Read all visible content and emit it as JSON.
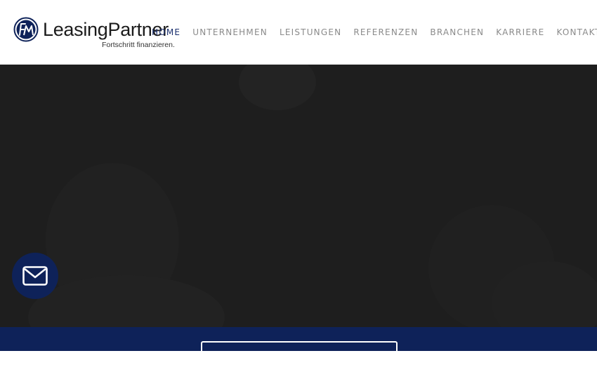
{
  "brand": {
    "name": "LeasingPartner",
    "tagline": "Fortschritt finanzieren.",
    "monogram": "FM",
    "colors": {
      "primary": "#0e2259",
      "nav_active": "#1a2f6e",
      "nav": "#8a8a8a",
      "hero_bg": "#1e1e1e"
    }
  },
  "nav": {
    "items": [
      {
        "label": "HOME",
        "active": true
      },
      {
        "label": "UNTERNEHMEN",
        "active": false
      },
      {
        "label": "LEISTUNGEN",
        "active": false
      },
      {
        "label": "REFERENZEN",
        "active": false
      },
      {
        "label": "BRANCHEN",
        "active": false
      },
      {
        "label": "KARRIERE",
        "active": false
      },
      {
        "label": "KONTAKT",
        "active": false
      }
    ]
  },
  "contact_fab": {
    "icon": "mail-icon"
  },
  "cta": {
    "label": ""
  }
}
